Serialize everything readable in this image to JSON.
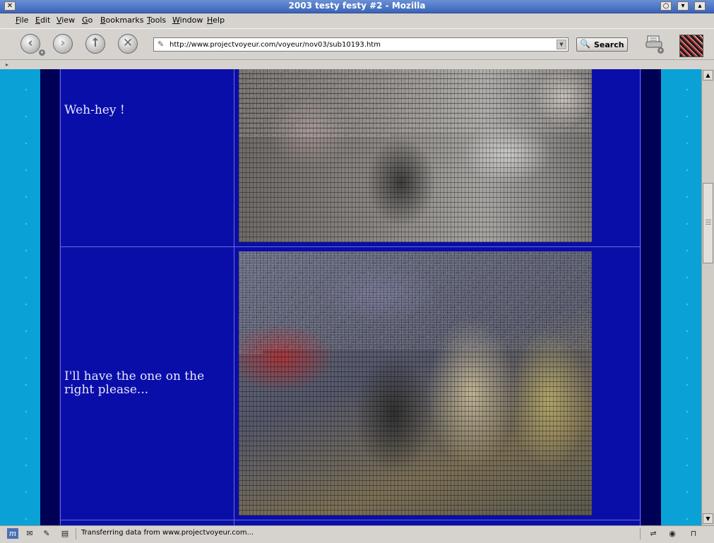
{
  "window": {
    "title": "2003 testy festy #2 - Mozilla",
    "close_glyph": "✕",
    "buttons": [
      "○",
      "▾",
      "▴"
    ]
  },
  "menu": [
    "File",
    "Edit",
    "View",
    "Go",
    "Bookmarks",
    "Tools",
    "Window",
    "Help"
  ],
  "nav": {
    "back_icon": "arrow-left-icon",
    "forward_icon": "arrow-right-icon",
    "reload_icon": "reload-icon",
    "stop_icon": "stop-icon",
    "url": "http://www.projectvoyeur.com/voyeur/nov03/sub10193.htm",
    "search_label": "Search"
  },
  "content": {
    "colors": {
      "main_blue": "#0a0ea8",
      "navy": "#000055",
      "cyan": "#0aa2d6"
    },
    "rows": [
      {
        "caption": "Weh-hey !"
      },
      {
        "caption": "I'll have the one on the right please..."
      }
    ]
  },
  "status": {
    "text": "Transferring data from www.projectvoyeur.com..."
  }
}
